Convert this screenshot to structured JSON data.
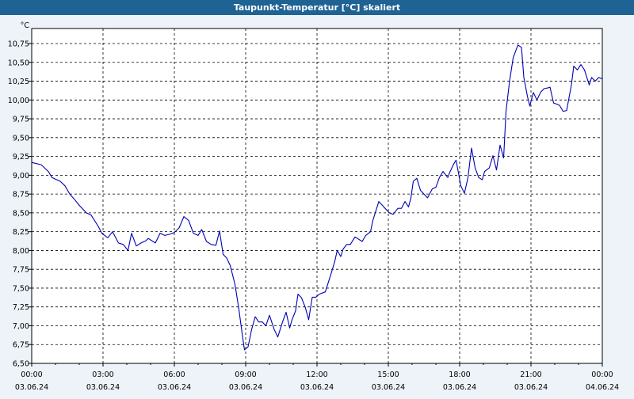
{
  "window": {
    "title": "Taupunkt-Temperatur [°C] skaliert"
  },
  "chart_data": {
    "type": "line",
    "title": "Taupunkt-Temperatur [°C] skaliert",
    "ylabel": "°C",
    "xlabel": "",
    "ylim": [
      6.5,
      10.95
    ],
    "xlim": [
      0,
      24
    ],
    "grid": true,
    "yticks": [
      "6,50",
      "6,75",
      "7,00",
      "7,25",
      "7,50",
      "7,75",
      "8,00",
      "8,25",
      "8,50",
      "8,75",
      "9,00",
      "9,25",
      "9,50",
      "9,75",
      "10,00",
      "10,25",
      "10,50",
      "10,75"
    ],
    "xticks": [
      {
        "time": "00:00",
        "date": "03.06.24"
      },
      {
        "time": "03:00",
        "date": "03.06.24"
      },
      {
        "time": "06:00",
        "date": "03.06.24"
      },
      {
        "time": "09:00",
        "date": "03.06.24"
      },
      {
        "time": "12:00",
        "date": "03.06.24"
      },
      {
        "time": "15:00",
        "date": "03.06.24"
      },
      {
        "time": "18:00",
        "date": "03.06.24"
      },
      {
        "time": "21:00",
        "date": "03.06.24"
      },
      {
        "time": "00:00",
        "date": "04.06.24"
      }
    ],
    "series": [
      {
        "color": "#0000b4",
        "points": [
          [
            0.0,
            9.17
          ],
          [
            0.4,
            9.14
          ],
          [
            0.7,
            9.05
          ],
          [
            0.85,
            8.97
          ],
          [
            1.2,
            8.92
          ],
          [
            1.4,
            8.86
          ],
          [
            1.6,
            8.75
          ],
          [
            1.85,
            8.66
          ],
          [
            2.0,
            8.6
          ],
          [
            2.3,
            8.5
          ],
          [
            2.5,
            8.47
          ],
          [
            2.8,
            8.32
          ],
          [
            2.95,
            8.23
          ],
          [
            3.2,
            8.17
          ],
          [
            3.4,
            8.25
          ],
          [
            3.65,
            8.1
          ],
          [
            3.85,
            8.08
          ],
          [
            4.05,
            8.0
          ],
          [
            4.2,
            8.23
          ],
          [
            4.4,
            8.06
          ],
          [
            4.6,
            8.1
          ],
          [
            4.8,
            8.13
          ],
          [
            4.9,
            8.16
          ],
          [
            5.2,
            8.1
          ],
          [
            5.4,
            8.23
          ],
          [
            5.6,
            8.2
          ],
          [
            5.85,
            8.22
          ],
          [
            6.0,
            8.24
          ],
          [
            6.2,
            8.3
          ],
          [
            6.4,
            8.45
          ],
          [
            6.6,
            8.4
          ],
          [
            6.8,
            8.23
          ],
          [
            7.0,
            8.2
          ],
          [
            7.15,
            8.28
          ],
          [
            7.35,
            8.12
          ],
          [
            7.55,
            8.08
          ],
          [
            7.75,
            8.07
          ],
          [
            7.9,
            8.26
          ],
          [
            8.05,
            7.95
          ],
          [
            8.2,
            7.9
          ],
          [
            8.35,
            7.8
          ],
          [
            8.55,
            7.55
          ],
          [
            8.7,
            7.25
          ],
          [
            8.85,
            6.9
          ],
          [
            8.95,
            6.68
          ],
          [
            9.1,
            6.72
          ],
          [
            9.25,
            6.95
          ],
          [
            9.4,
            7.12
          ],
          [
            9.55,
            7.05
          ],
          [
            9.7,
            7.05
          ],
          [
            9.85,
            7.0
          ],
          [
            10.0,
            7.14
          ],
          [
            10.2,
            6.95
          ],
          [
            10.35,
            6.85
          ],
          [
            10.55,
            7.05
          ],
          [
            10.7,
            7.18
          ],
          [
            10.85,
            6.97
          ],
          [
            10.95,
            7.08
          ],
          [
            11.1,
            7.2
          ],
          [
            11.2,
            7.42
          ],
          [
            11.35,
            7.37
          ],
          [
            11.5,
            7.25
          ],
          [
            11.65,
            7.08
          ],
          [
            11.8,
            7.38
          ],
          [
            11.95,
            7.38
          ],
          [
            12.1,
            7.42
          ],
          [
            12.35,
            7.45
          ],
          [
            12.5,
            7.6
          ],
          [
            12.6,
            7.7
          ],
          [
            12.75,
            7.86
          ],
          [
            12.85,
            8.0
          ],
          [
            13.0,
            7.92
          ],
          [
            13.1,
            8.02
          ],
          [
            13.25,
            8.08
          ],
          [
            13.4,
            8.08
          ],
          [
            13.6,
            8.18
          ],
          [
            13.75,
            8.15
          ],
          [
            13.9,
            8.12
          ],
          [
            14.05,
            8.2
          ],
          [
            14.25,
            8.25
          ],
          [
            14.35,
            8.4
          ],
          [
            14.5,
            8.55
          ],
          [
            14.6,
            8.65
          ],
          [
            14.75,
            8.6
          ],
          [
            14.95,
            8.53
          ],
          [
            15.05,
            8.5
          ],
          [
            15.2,
            8.48
          ],
          [
            15.4,
            8.56
          ],
          [
            15.55,
            8.56
          ],
          [
            15.7,
            8.65
          ],
          [
            15.85,
            8.58
          ],
          [
            15.95,
            8.7
          ],
          [
            16.05,
            8.92
          ],
          [
            16.2,
            8.96
          ],
          [
            16.35,
            8.8
          ],
          [
            16.5,
            8.75
          ],
          [
            16.65,
            8.7
          ],
          [
            16.85,
            8.82
          ],
          [
            17.0,
            8.84
          ],
          [
            17.15,
            8.97
          ],
          [
            17.3,
            9.05
          ],
          [
            17.5,
            8.97
          ],
          [
            17.6,
            9.05
          ],
          [
            17.75,
            9.15
          ],
          [
            17.85,
            9.2
          ],
          [
            18.05,
            8.86
          ],
          [
            18.2,
            8.76
          ],
          [
            18.35,
            8.97
          ],
          [
            18.5,
            9.36
          ],
          [
            18.65,
            9.1
          ],
          [
            18.8,
            8.97
          ],
          [
            18.95,
            8.94
          ],
          [
            19.05,
            9.05
          ],
          [
            19.25,
            9.1
          ],
          [
            19.4,
            9.26
          ],
          [
            19.55,
            9.07
          ],
          [
            19.7,
            9.4
          ],
          [
            19.85,
            9.23
          ],
          [
            19.95,
            9.85
          ],
          [
            20.1,
            10.25
          ],
          [
            20.25,
            10.56
          ],
          [
            20.45,
            10.73
          ],
          [
            20.6,
            10.7
          ],
          [
            20.7,
            10.3
          ],
          [
            20.85,
            10.05
          ],
          [
            20.95,
            9.92
          ],
          [
            21.1,
            10.1
          ],
          [
            21.25,
            10.0
          ],
          [
            21.4,
            10.1
          ],
          [
            21.55,
            10.15
          ],
          [
            21.7,
            10.16
          ],
          [
            21.8,
            10.17
          ],
          [
            21.95,
            9.96
          ],
          [
            22.05,
            9.95
          ],
          [
            22.2,
            9.93
          ],
          [
            22.35,
            9.85
          ],
          [
            22.5,
            9.86
          ],
          [
            22.7,
            10.2
          ],
          [
            22.8,
            10.45
          ],
          [
            22.95,
            10.4
          ],
          [
            23.1,
            10.47
          ],
          [
            23.25,
            10.4
          ],
          [
            23.35,
            10.3
          ],
          [
            23.45,
            10.2
          ],
          [
            23.55,
            10.3
          ],
          [
            23.7,
            10.25
          ],
          [
            23.85,
            10.3
          ],
          [
            24.0,
            10.28
          ]
        ]
      }
    ]
  }
}
